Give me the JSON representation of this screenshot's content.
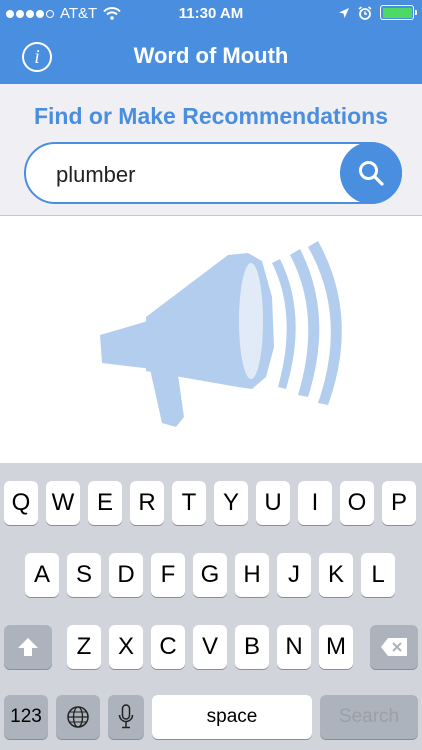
{
  "status_bar": {
    "carrier": "AT&T",
    "time": "11:30 AM",
    "battery_color": "#4cd964"
  },
  "header": {
    "title": "Word of Mouth",
    "info_icon": "info-icon",
    "info_glyph": "i",
    "background": "#4a8ee0"
  },
  "search": {
    "subtitle": "Find or Make Recommendations",
    "query": "plumber",
    "button_icon": "search-icon"
  },
  "hero": {
    "icon": "megaphone-icon",
    "color": "#b3cdee"
  },
  "keyboard": {
    "row1": [
      "Q",
      "W",
      "E",
      "R",
      "T",
      "Y",
      "U",
      "I",
      "O",
      "P"
    ],
    "row2": [
      "A",
      "S",
      "D",
      "F",
      "G",
      "H",
      "J",
      "K",
      "L"
    ],
    "row3": [
      "Z",
      "X",
      "C",
      "V",
      "B",
      "N",
      "M"
    ],
    "numbers_label": "123",
    "space_label": "space",
    "search_label": "Search"
  }
}
